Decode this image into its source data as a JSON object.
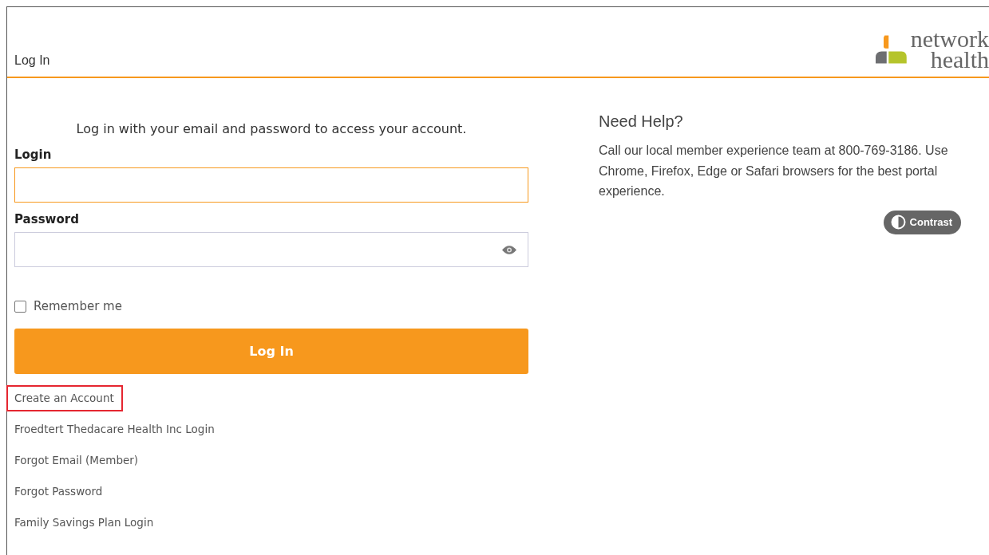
{
  "header": {
    "title": "Log In",
    "logo": {
      "line_1": "network",
      "line_2": "health"
    }
  },
  "form": {
    "intro": "Log in with your email and password to access your account.",
    "fields": [
      {
        "label": "Login",
        "kind": "text",
        "focused": true
      },
      {
        "label": "Password",
        "kind": "password",
        "focused": false
      }
    ],
    "remember": {
      "label": "Remember me",
      "checked": false
    },
    "submit": "Log In",
    "links": [
      {
        "label": "Create an Account",
        "highlighted": true
      },
      {
        "label": "Froedtert Thedacare Health Inc Login",
        "highlighted": false
      },
      {
        "label": "Forgot Email (Member)",
        "highlighted": false
      },
      {
        "label": "Forgot Password",
        "highlighted": false
      },
      {
        "label": "Family Savings Plan Login",
        "highlighted": false
      }
    ]
  },
  "help": {
    "title": "Need Help?",
    "text": "Call our local member experience team at 800-769-3186. Use Chrome, Firefox, Edge or Safari browsers for the best portal experience.",
    "contrast_button": "Contrast"
  }
}
